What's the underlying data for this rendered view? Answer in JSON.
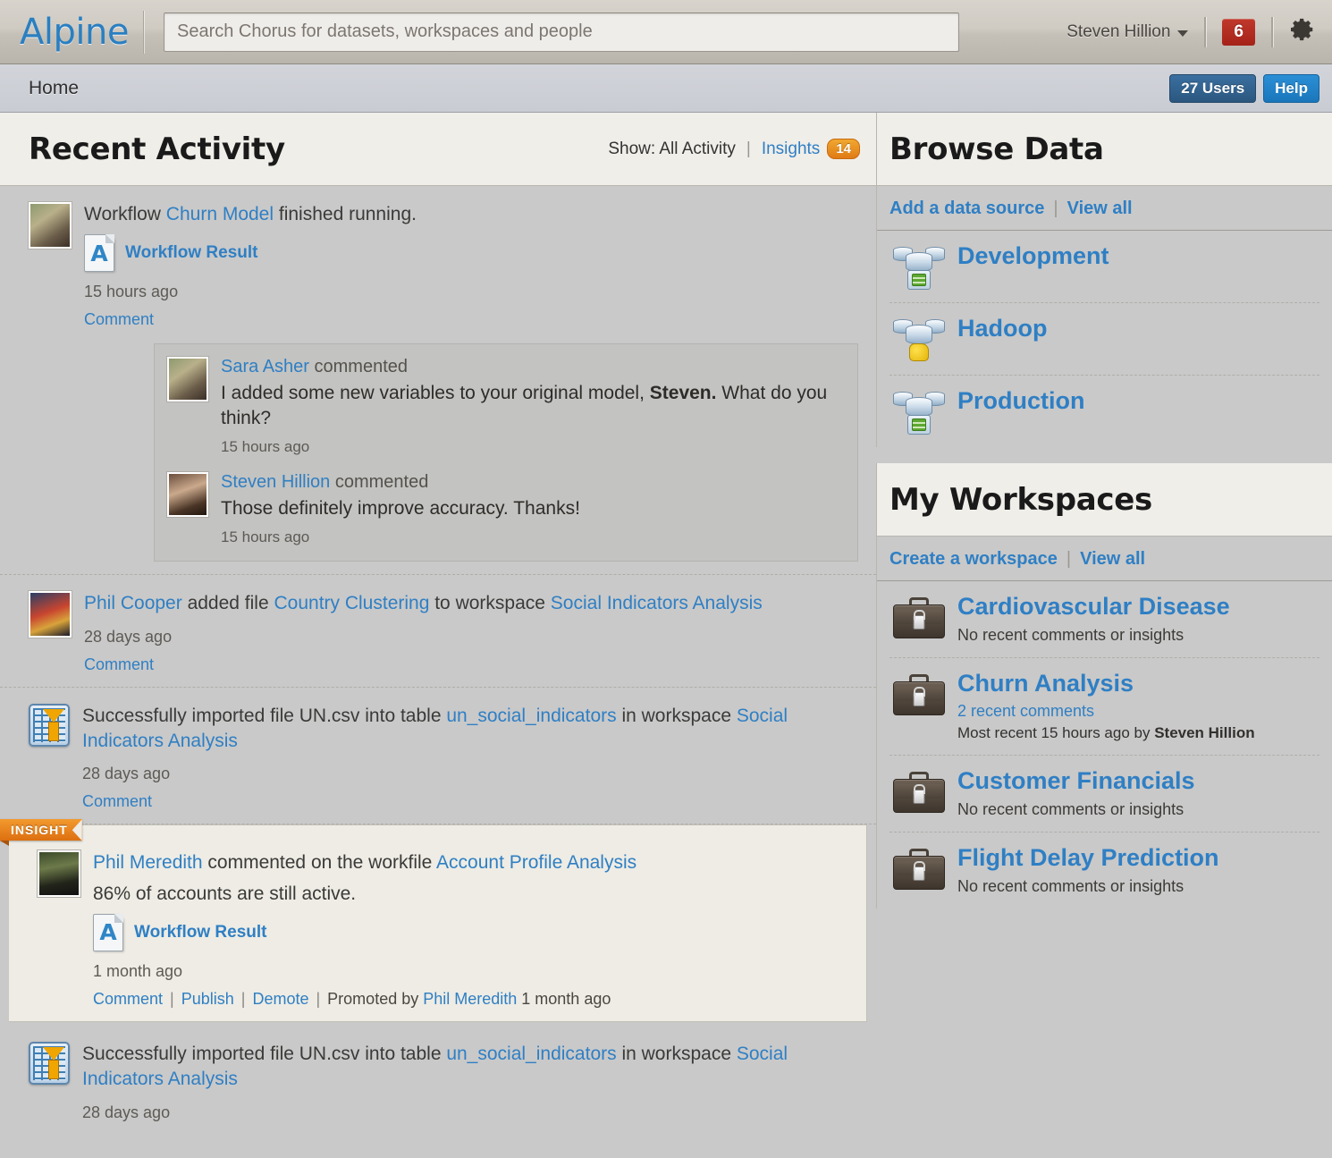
{
  "app": {
    "logo_text": "Alpine",
    "notification_count": "6",
    "gear_icon": "gear-icon"
  },
  "search": {
    "placeholder": "Search Chorus for datasets, workspaces and people",
    "value": ""
  },
  "user_menu": {
    "name": "Steven Hillion",
    "caret": "chevron-down-icon"
  },
  "breadcrumb": {
    "home": "Home",
    "users_button": "27 Users",
    "help_button": "Help"
  },
  "recent_activity": {
    "title": "Recent Activity",
    "show_label": "Show: All Activity",
    "separator": "|",
    "insights_label": "Insights",
    "insights_count": "14",
    "items": [
      {
        "id": "workflow-churn-model",
        "avatar": "avatar-sara-asher",
        "text_parts": [
          {
            "t": "Workflow ",
            "link": false
          },
          {
            "t": "Churn Model",
            "link": true
          },
          {
            "t": " finished running.",
            "link": false
          }
        ],
        "attachment_label": "Workflow Result",
        "attachment_icon": "workflow-result-icon",
        "timestamp": "15 hours ago",
        "actions": [
          {
            "label": "Comment",
            "link": true
          }
        ],
        "comments": [
          {
            "author": "Sara Asher",
            "verb": "commented",
            "body_pre": "I added some new variables to your original model, ",
            "body_bold": "Steven.",
            "body_post": " What do you think?",
            "timestamp": "15 hours ago",
            "avatar": "avatar-sara-asher"
          },
          {
            "author": "Steven Hillion",
            "verb": "commented",
            "body_pre": "Those definitely improve accuracy. Thanks!",
            "body_bold": "",
            "body_post": "",
            "timestamp": "15 hours ago",
            "avatar": "avatar-steven-hillion"
          }
        ]
      },
      {
        "id": "phil-cooper-added-file",
        "avatar": "avatar-phil-cooper",
        "text_parts": [
          {
            "t": "Phil Cooper",
            "link": true
          },
          {
            "t": " added file ",
            "link": false
          },
          {
            "t": "Country Clustering",
            "link": true
          },
          {
            "t": " to workspace ",
            "link": false
          },
          {
            "t": "Social Indicators Analysis",
            "link": true
          }
        ],
        "timestamp": "28 days ago",
        "actions": [
          {
            "label": "Comment",
            "link": true
          }
        ]
      },
      {
        "id": "import-un-csv-1",
        "avatar": "import-file-icon",
        "text_parts": [
          {
            "t": "Successfully imported file UN.csv into table ",
            "link": false
          },
          {
            "t": "un_social_indicators",
            "link": true
          },
          {
            "t": " in workspace ",
            "link": false
          },
          {
            "t": "Social Indicators Analysis",
            "link": true
          }
        ],
        "timestamp": "28 days ago",
        "actions": [
          {
            "label": "Comment",
            "link": true
          }
        ]
      },
      {
        "id": "insight-phil-meredith",
        "is_insight": true,
        "ribbon_label": "INSIGHT",
        "avatar": "avatar-phil-meredith",
        "text_parts": [
          {
            "t": "Phil Meredith",
            "link": true
          },
          {
            "t": " commented on the workfile ",
            "link": false
          },
          {
            "t": "Account Profile Analysis",
            "link": true
          }
        ],
        "body": "86% of accounts are still active.",
        "attachment_label": "Workflow Result",
        "attachment_icon": "workflow-result-icon",
        "timestamp": "1 month ago",
        "actions": [
          {
            "label": "Comment",
            "link": true
          },
          {
            "label": "Publish",
            "link": true
          },
          {
            "label": "Demote",
            "link": true
          }
        ],
        "promoted_prefix": "Promoted by ",
        "promoted_by": "Phil Meredith",
        "promoted_time": " 1 month ago"
      },
      {
        "id": "import-un-csv-2",
        "avatar": "import-file-icon",
        "text_parts": [
          {
            "t": "Successfully imported file UN.csv into table ",
            "link": false
          },
          {
            "t": "un_social_indicators",
            "link": true
          },
          {
            "t": " in workspace ",
            "link": false
          },
          {
            "t": "Social Indicators Analysis",
            "link": true
          }
        ],
        "timestamp": "28 days ago",
        "actions": []
      }
    ]
  },
  "browse_data": {
    "title": "Browse Data",
    "add_link": "Add a data source",
    "view_all": "View all",
    "items": [
      {
        "label": "Development",
        "icon": "database-icon"
      },
      {
        "label": "Hadoop",
        "icon": "hadoop-database-icon"
      },
      {
        "label": "Production",
        "icon": "database-icon"
      }
    ]
  },
  "my_workspaces": {
    "title": "My Workspaces",
    "create_link": "Create a workspace",
    "view_all": "View all",
    "items": [
      {
        "label": "Cardiovascular Disease",
        "icon": "briefcase-icon",
        "sub": "No recent comments or insights",
        "sub_is_link": false,
        "sub2": ""
      },
      {
        "label": "Churn Analysis",
        "icon": "briefcase-icon",
        "sub": "2 recent comments",
        "sub_is_link": true,
        "sub2_lead": "Most recent 15 hours ago by ",
        "sub2": "Steven Hillion"
      },
      {
        "label": "Customer Financials",
        "icon": "briefcase-icon",
        "sub": "No recent comments or insights",
        "sub_is_link": false,
        "sub2": ""
      },
      {
        "label": "Flight Delay Prediction",
        "icon": "briefcase-icon",
        "sub": "No recent comments or insights",
        "sub_is_link": false,
        "sub2": ""
      }
    ]
  },
  "colors": {
    "link_blue": "#2f7fc4",
    "accent_orange": "#e07b15",
    "notification_red": "#b32b1f",
    "help_blue": "#1a76bb"
  }
}
